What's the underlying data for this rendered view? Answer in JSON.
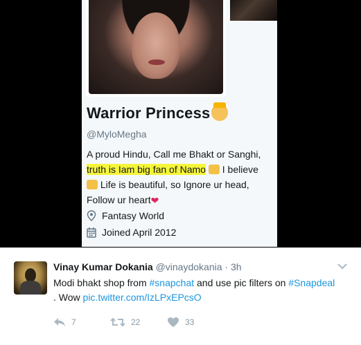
{
  "profile": {
    "name": "Warrior Princess",
    "handle": "@MyloMegha",
    "bio": {
      "line1": "A proud Hindu, Call me Bhakt or Sanghi,",
      "highlight": "truth is Iam big fan of Namo",
      "after_highlight": "I believe",
      "line3": "Life is beautiful, so Ignore ur head,",
      "line4": "Follow ur heart"
    },
    "location": "Fantasy World",
    "joined": "Joined April 2012"
  },
  "tweet": {
    "author_name": "Vinay Kumar Dokania",
    "author_handle": "@vinaydokania",
    "separator": "·",
    "time": "3h",
    "text": {
      "part1": "Modi bhakt shop from ",
      "hashtag1": "#snapchat",
      "part2": " and use pic filters on ",
      "hashtag2": "#Snapdeal",
      "part3": ". Wow ",
      "link": "pic.twitter.com/IzLPxEPcsO"
    },
    "actions": {
      "reply_count": "7",
      "retweet_count": "22",
      "like_count": "33"
    }
  },
  "colors": {
    "link": "#1b95e0",
    "highlight": "#f5f53a",
    "heart": "#e0245e",
    "muted": "#657786"
  }
}
